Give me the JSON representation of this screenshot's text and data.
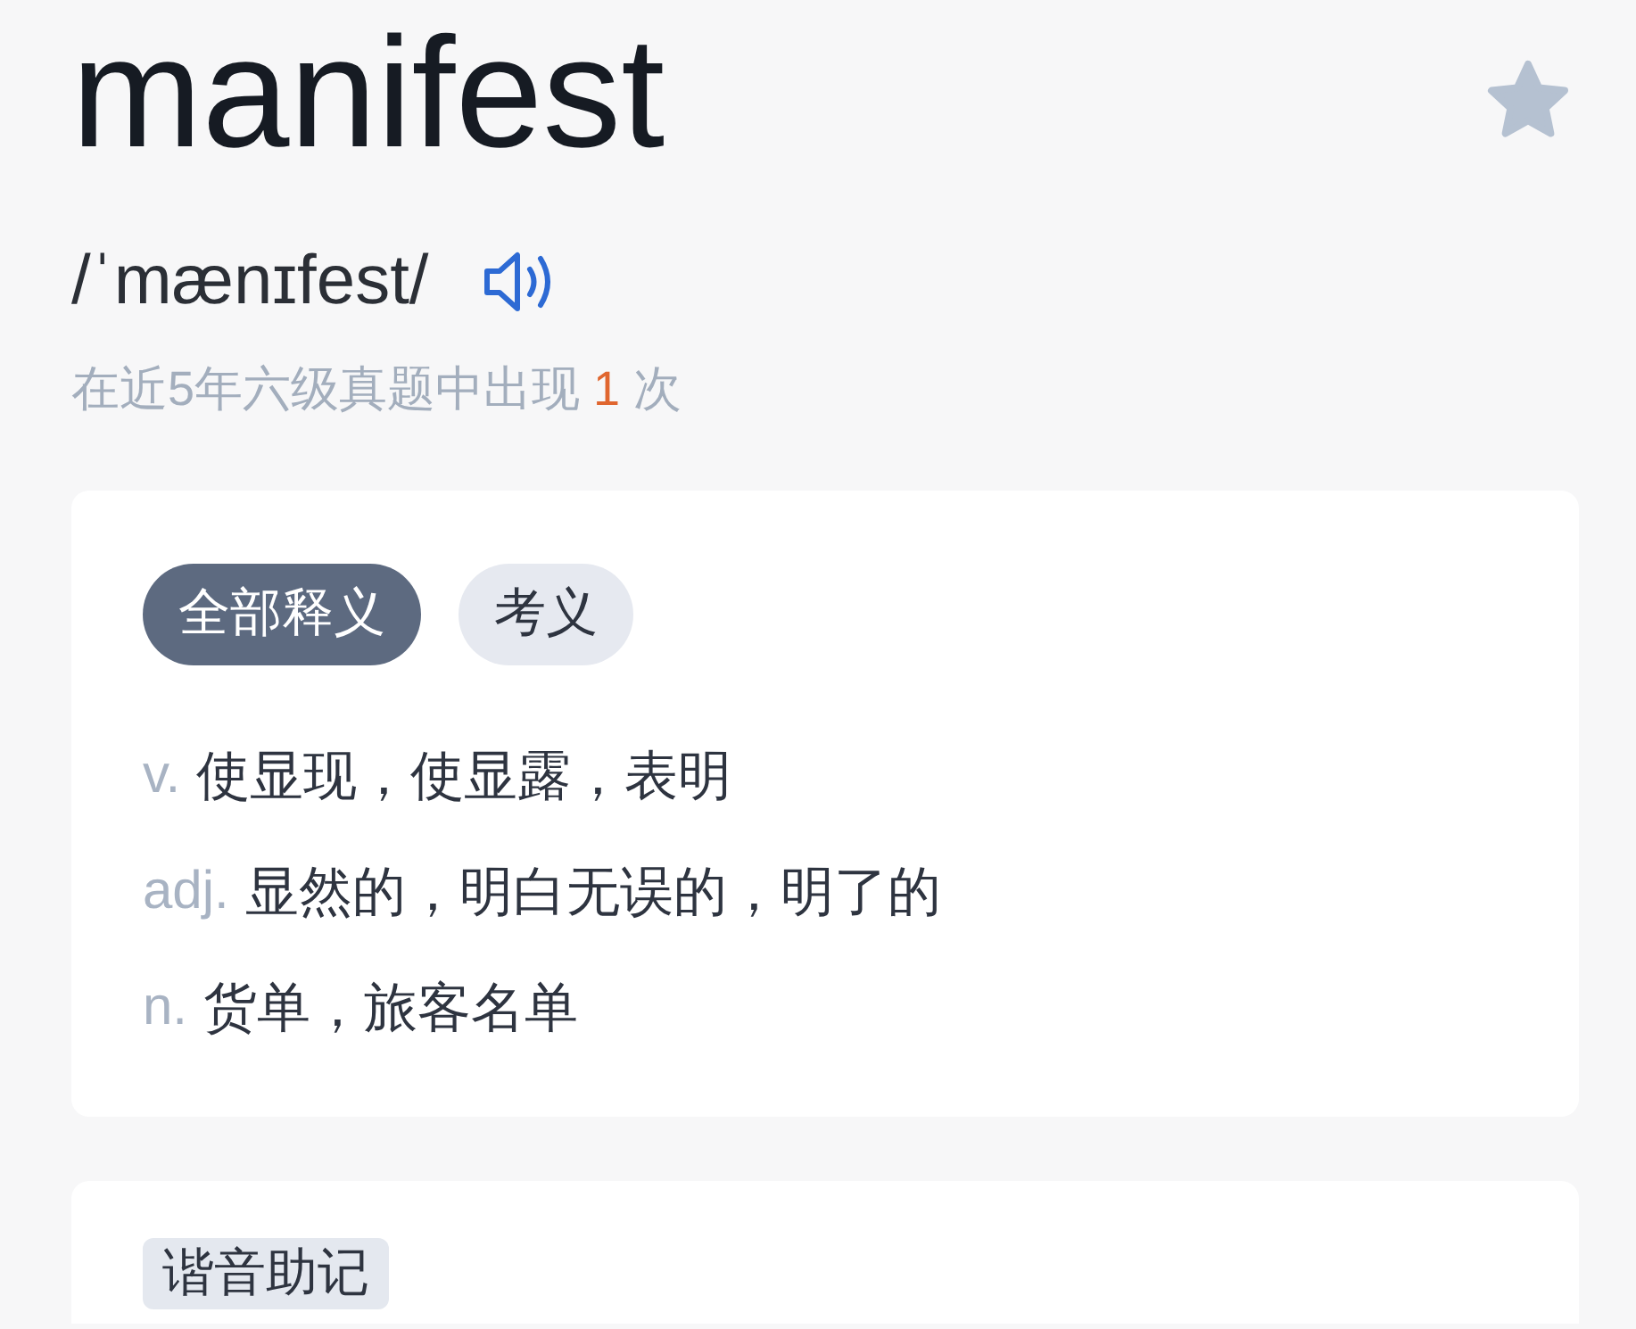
{
  "word": {
    "text": "manifest",
    "starred": false
  },
  "pronunciation": {
    "phonetic": "/ˈmænɪfest/"
  },
  "frequency": "在近5年六级真题中出现 **1** 次",
  "definitions_card": {
    "tabs": [
      {
        "label": "全部释义",
        "selected": true
      },
      {
        "label": "考义",
        "selected": false
      }
    ],
    "definitions": [
      {
        "part_of_speech": "v.",
        "meaning": "使显现，使显露，表明"
      },
      {
        "part_of_speech": "adj.",
        "meaning": "显然的，明白无误的，明了的"
      },
      {
        "part_of_speech": "n.",
        "meaning": "货单，旅客名单"
      }
    ]
  },
  "mnemonic_card": {
    "tag": "谐音助记"
  }
}
